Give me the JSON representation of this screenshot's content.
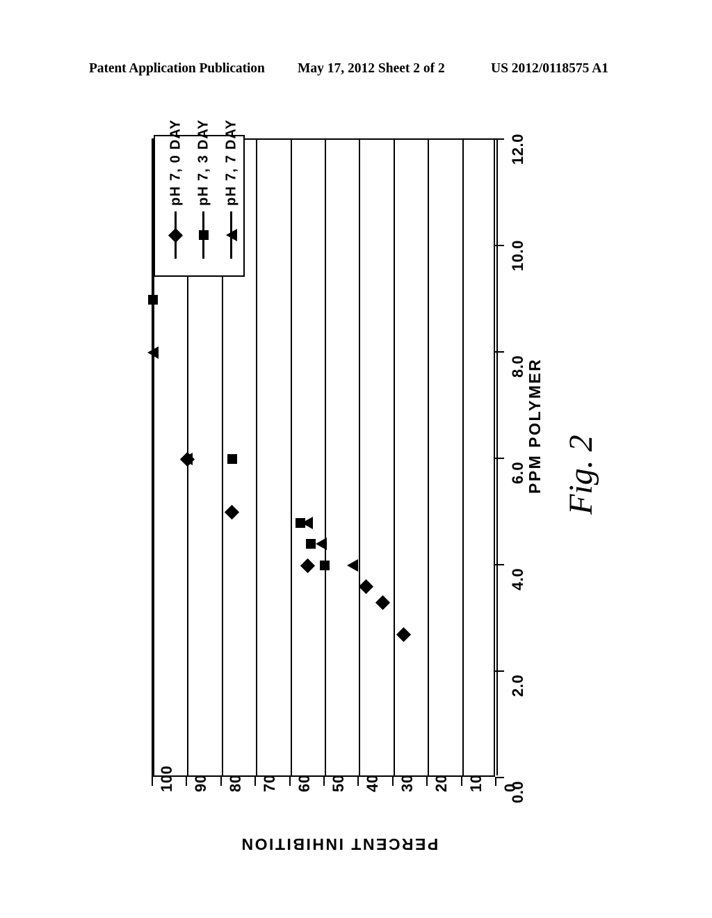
{
  "header": {
    "left": "Patent Application Publication",
    "middle": "May 17, 2012  Sheet 2 of 2",
    "right": "US 2012/0118575 A1"
  },
  "figure": {
    "caption": "Fig. 2"
  },
  "chart_data": {
    "type": "scatter",
    "title": "",
    "xlabel": "PERCENT INHIBITION",
    "ylabel": "PPM POLYMER",
    "orientation": "rotated-90-ccw",
    "xlim": [
      0,
      100
    ],
    "ylim": [
      0.0,
      12.0
    ],
    "xticks": [
      100,
      90,
      80,
      70,
      60,
      50,
      40,
      30,
      20,
      10,
      0
    ],
    "xticklabels": [
      "100",
      "90",
      "80",
      "70",
      "60",
      "50",
      "40",
      "30",
      "20",
      "10",
      "0"
    ],
    "yticks": [
      0.0,
      2.0,
      4.0,
      6.0,
      8.0,
      10.0,
      12.0
    ],
    "yticklabels": [
      "0.0",
      "2.0",
      "4.0",
      "6.0",
      "8.0",
      "10.0",
      "12.0"
    ],
    "grid": "vertical-only",
    "legend_position": "top-left-inside",
    "series": [
      {
        "name": "pH 7, 0 DAY",
        "marker": "diamond",
        "points": [
          {
            "percent_inhibition": 90,
            "ppm_polymer": 6.0
          },
          {
            "percent_inhibition": 77,
            "ppm_polymer": 5.0
          },
          {
            "percent_inhibition": 55,
            "ppm_polymer": 4.0
          },
          {
            "percent_inhibition": 38,
            "ppm_polymer": 3.6
          },
          {
            "percent_inhibition": 33,
            "ppm_polymer": 3.3
          },
          {
            "percent_inhibition": 27,
            "ppm_polymer": 2.7
          }
        ]
      },
      {
        "name": "pH 7, 3 DAY",
        "marker": "square",
        "points": [
          {
            "percent_inhibition": 100,
            "ppm_polymer": 9.0
          },
          {
            "percent_inhibition": 77,
            "ppm_polymer": 6.0
          },
          {
            "percent_inhibition": 57,
            "ppm_polymer": 4.8
          },
          {
            "percent_inhibition": 54,
            "ppm_polymer": 4.4
          },
          {
            "percent_inhibition": 50,
            "ppm_polymer": 4.0
          }
        ]
      },
      {
        "name": "pH 7, 7 DAY",
        "marker": "triangle",
        "points": [
          {
            "percent_inhibition": 100,
            "ppm_polymer": 8.0
          },
          {
            "percent_inhibition": 90,
            "ppm_polymer": 6.0
          },
          {
            "percent_inhibition": 55,
            "ppm_polymer": 4.8
          },
          {
            "percent_inhibition": 51,
            "ppm_polymer": 4.4
          },
          {
            "percent_inhibition": 42,
            "ppm_polymer": 4.0
          }
        ]
      }
    ]
  }
}
